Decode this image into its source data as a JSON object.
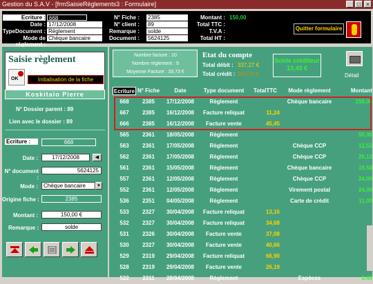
{
  "window": {
    "title": "Gestion du S.A.V - [frmSaisieRèglements3 : Formulaire]"
  },
  "header": {
    "ecriture_label": "Ecriture :",
    "ecriture": "668",
    "date_label": "Date :",
    "date": "17/12/2008",
    "typedoc_label": "TypeDocument :",
    "typedoc": "Règlement",
    "mode_label": "Mode de règlement :",
    "mode": "Chèque bancaire",
    "nfiche_label": "N° Fiche :",
    "nfiche": "2385",
    "nclient_label": "N° client :",
    "nclient": "89",
    "remarque_label": "Remarque :",
    "remarque": "solde",
    "document_label": "Document :",
    "document": "5624125",
    "montant_label": "Montant :",
    "montant": "150,00",
    "totalttc_label": "Total TTC :",
    "tva_label": "T.V.A :",
    "totalht_label": "Total HT :",
    "quit_label": "Quitter formulaire"
  },
  "left": {
    "title": "Saisie règlement",
    "init_label": "Initialisation de la fiche",
    "client_name": "Koskitalo   Pierre",
    "dossier_parent": "N° Dossier parent : 89",
    "lien_dossier": "Lien avec le dossier : 89",
    "form": {
      "ecriture_label": "Ecriture :",
      "ecriture": "668",
      "date_label": "Date :",
      "date": "17/12/2008",
      "ndoc_label": "N° document :",
      "ndoc": "5624125",
      "mode_label": "Mode :",
      "mode": "Chèque bancaire",
      "origine_label": "Origine fiche :",
      "origine": "2385",
      "montant_label": "Montant :",
      "montant": "150,00 €",
      "remarque_label": "Remarque :",
      "remarque": "solde"
    },
    "nav": {
      "first": "DEBUT",
      "last": "FIN"
    }
  },
  "right": {
    "stats": {
      "nb_facture": "Nombre facture : 10",
      "nb_reglement": "Nombre règlement : 9",
      "moyenne": "Moyenne Facture : 33,73 €"
    },
    "etat_title": "Etat du compte",
    "total_debit_label": "Total débit :",
    "total_debit": "337,27 €",
    "total_credit_label": "Total crédit :",
    "total_credit": "350,70 €",
    "solde_label": "Solde créditeur",
    "solde_value": "13,43 €",
    "detail_label": "Détail"
  },
  "table": {
    "headers": [
      "Ecriture",
      "N° Fiche",
      "Date",
      "Type document",
      "TotalTTC",
      "Mode règlement",
      "Montant"
    ],
    "rows": [
      [
        "668",
        "2385",
        "17/12/2008",
        "Règlement",
        "",
        "Chèque bancaire",
        "150,00"
      ],
      [
        "667",
        "2385",
        "16/12/2008",
        "Facture reliquat",
        "11,24",
        "",
        ""
      ],
      [
        "666",
        "2385",
        "16/12/2008",
        "Facture vente",
        "45,45",
        "",
        ""
      ],
      [
        "565",
        "2361",
        "18/05/2008",
        "Règlement",
        "",
        "",
        "50,00"
      ],
      [
        "563",
        "2361",
        "17/05/2008",
        "Règlement",
        "",
        "Chèque CCP",
        "12,52"
      ],
      [
        "562",
        "2361",
        "17/05/2008",
        "Règlement",
        "",
        "Chèque CCP",
        "25,12"
      ],
      [
        "561",
        "2361",
        "15/05/2008",
        "Règlement",
        "",
        "Chèque bancaire",
        "19,58"
      ],
      [
        "557",
        "2361",
        "12/05/2008",
        "Règlement",
        "",
        "Chèque CCP",
        "24,00"
      ],
      [
        "552",
        "2361",
        "12/05/2008",
        "Règlement",
        "",
        "Virement postal",
        "24,00"
      ],
      [
        "536",
        "2351",
        "04/05/2008",
        "Règlement",
        "",
        "Carte de crédit",
        "11,00"
      ],
      [
        "533",
        "2327",
        "30/04/2008",
        "Facture reliquat",
        "13,16",
        "",
        ""
      ],
      [
        "532",
        "2327",
        "30/04/2008",
        "Facture reliquat",
        "34,68",
        "",
        ""
      ],
      [
        "531",
        "2326",
        "30/04/2008",
        "Facture vente",
        "37,08",
        "",
        ""
      ],
      [
        "530",
        "2327",
        "30/04/2008",
        "Facture vente",
        "40,66",
        "",
        ""
      ],
      [
        "529",
        "2319",
        "29/04/2008",
        "Facture reliquat",
        "66,90",
        "",
        ""
      ],
      [
        "528",
        "2319",
        "29/04/2008",
        "Facture vente",
        "26,19",
        "",
        ""
      ],
      [
        "522",
        "2311",
        "28/04/2008",
        "Règlement",
        "",
        "Espèces",
        "3,40"
      ]
    ]
  },
  "colors": {
    "accent": "#46a07e",
    "highlight": "#d21f1f",
    "value_yellow": "#ffd200",
    "value_green": "#3af03a"
  }
}
